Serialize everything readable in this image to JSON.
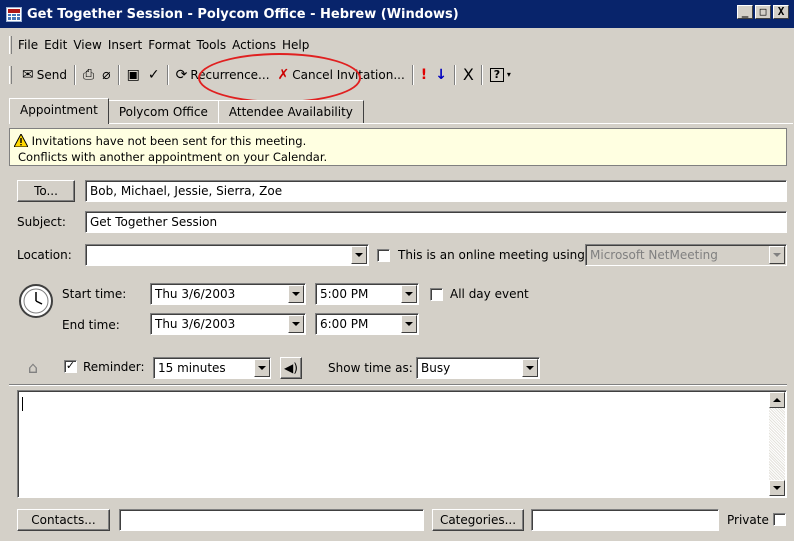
{
  "window": {
    "title": "Get Together Session - Polycom Office  - Hebrew (Windows)",
    "controls": [
      "_",
      "□",
      "X"
    ]
  },
  "menu": [
    "File",
    "Edit",
    "View",
    "Insert",
    "Format",
    "Tools",
    "Actions",
    "Help"
  ],
  "toolbar": {
    "send_label": "Send",
    "recurrence_label": "Recurrence...",
    "cancel_invitation_label": "Cancel Invitation...",
    "importance_high_icon": "!",
    "importance_low_icon": "↓",
    "delete_icon": "X",
    "help_icon": "?"
  },
  "tabs": [
    "Appointment",
    "Polycom Office",
    "Attendee Availability"
  ],
  "info": {
    "line1": "Invitations have not been sent for this meeting.",
    "line2": "Conflicts with another appointment on your Calendar."
  },
  "form": {
    "to_button": "To...",
    "to_value": "Bob, Michael, Jessie, Sierra, Zoe",
    "subject_label": "Subject:",
    "subject_value": "Get Together Session",
    "location_label": "Location:",
    "location_value": "",
    "online_label": "This is an online meeting using:",
    "online_value": "Microsoft NetMeeting",
    "start_label": "Start time:",
    "start_date": "Thu 3/6/2003",
    "start_time": "5:00 PM",
    "all_day_label": "All day event",
    "end_label": "End time:",
    "end_date": "Thu 3/6/2003",
    "end_time": "6:00 PM",
    "reminder_label": "Reminder:",
    "reminder_value": "15 minutes",
    "show_time_label": "Show time as:",
    "show_time_value": "Busy"
  },
  "footer": {
    "contacts_button": "Contacts...",
    "contacts_value": "",
    "categories_button": "Categories...",
    "categories_value": "",
    "private_label": "Private"
  },
  "colors": {
    "titlebar": "#08246b",
    "info_bg": "#ffffe1",
    "annotation_circle": "#e02020"
  }
}
